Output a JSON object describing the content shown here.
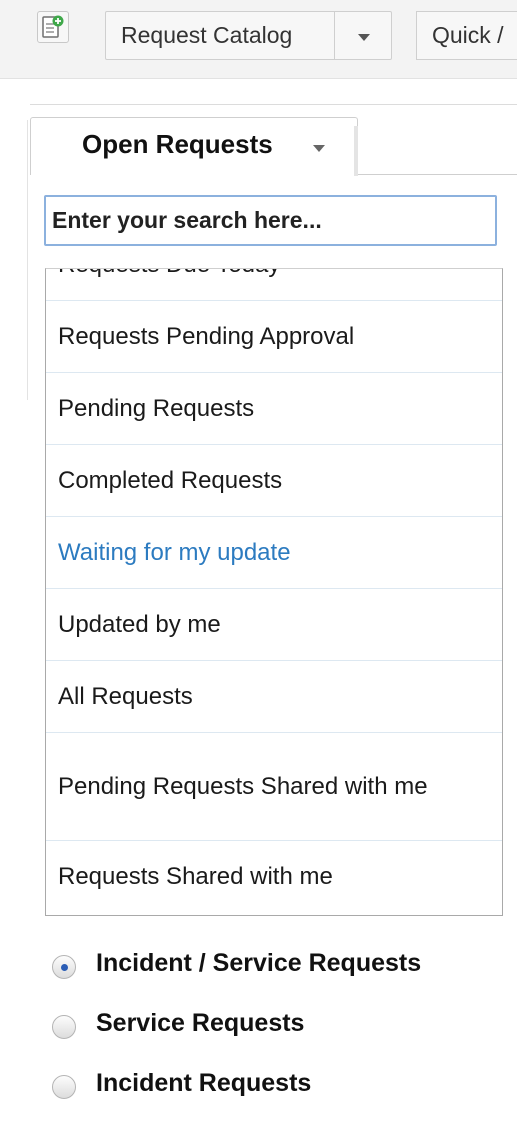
{
  "toolbar": {
    "new_request_icon": "new-request-icon",
    "request_catalog_label": "Request Catalog",
    "quick_label": "Quick /"
  },
  "tab": {
    "label": "Open Requests"
  },
  "search": {
    "placeholder": "Enter your search here..."
  },
  "filters": {
    "items": [
      {
        "label": "Requests Due Today"
      },
      {
        "label": "Requests Pending Approval"
      },
      {
        "label": "Pending Requests"
      },
      {
        "label": "Completed Requests"
      },
      {
        "label": "Waiting for my update"
      },
      {
        "label": "Updated by me"
      },
      {
        "label": "All Requests"
      },
      {
        "label": "Pending Requests Shared with me"
      },
      {
        "label": "Requests Shared with me"
      }
    ],
    "active_color": "#2c7bc0"
  },
  "request_types": {
    "options": [
      {
        "label": "Incident / Service Requests",
        "selected": true
      },
      {
        "label": "Service Requests",
        "selected": false
      },
      {
        "label": "Incident Requests",
        "selected": false
      }
    ]
  }
}
